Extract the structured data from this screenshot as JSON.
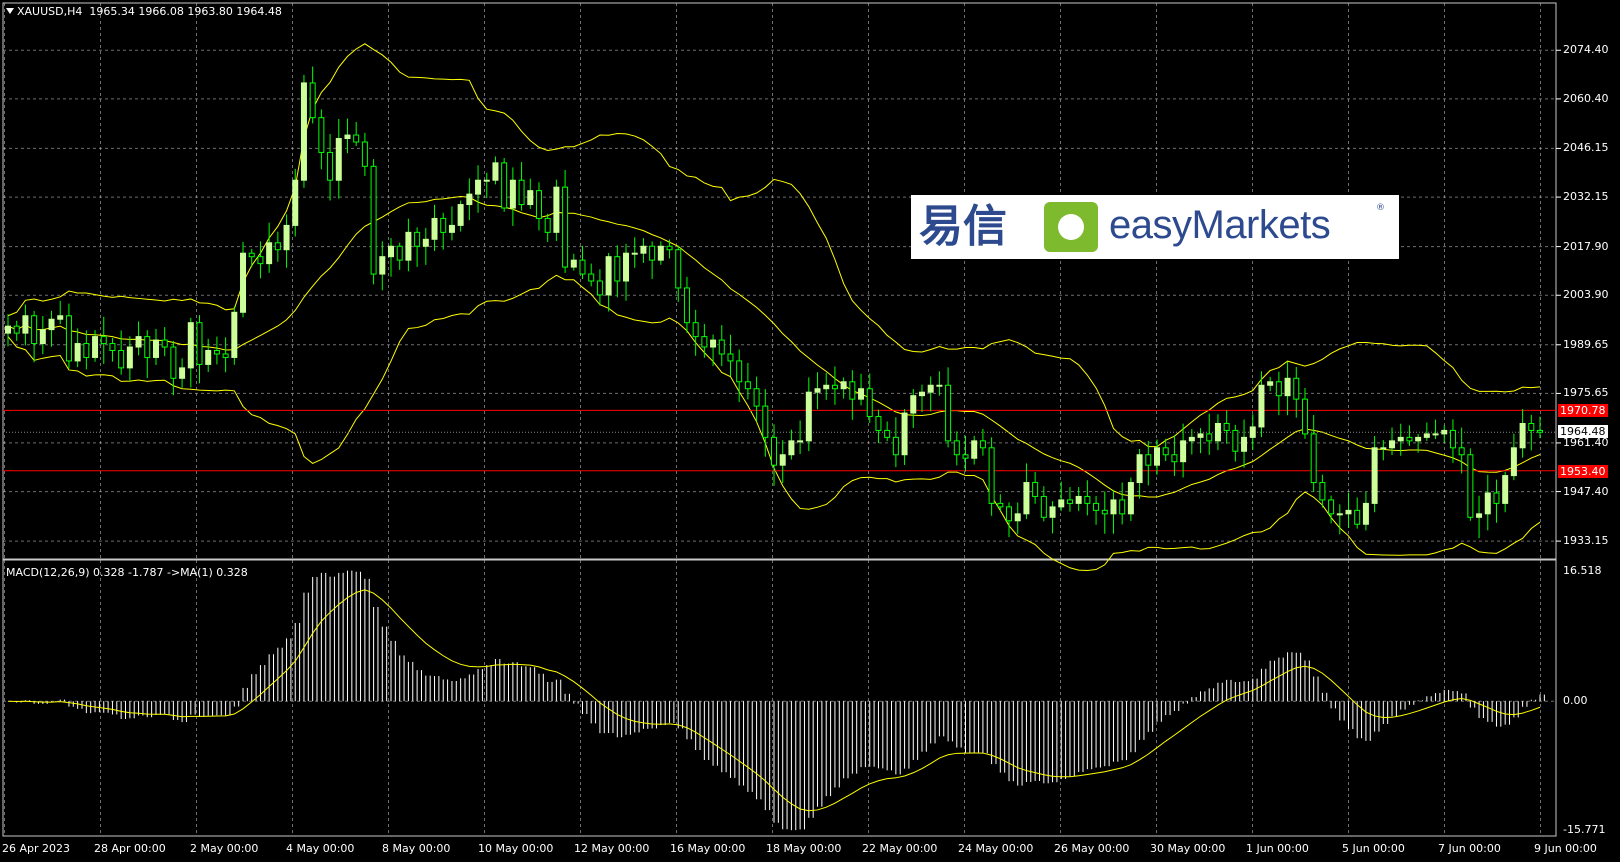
{
  "header": {
    "symbol": "XAUUSD,H4",
    "ohlc": "1965.34 1966.08 1963.80 1964.48"
  },
  "macd_header": "MACD(12,26,9) 0.328 -1.787  ->MA(1) 0.328",
  "logo": {
    "chinese": "易信",
    "english": "easyMarkets",
    "reg": "®"
  },
  "colors": {
    "background": "#000000",
    "grid": "#c8c8c8",
    "bull_candle": "#ccff99",
    "bear_candle": "#00ff00",
    "band": "#ffff00",
    "level": "#ff0000",
    "macd_hist": "#ffffff",
    "signal": "#ffff00"
  },
  "price_levels": {
    "upper": "1970.78",
    "lower": "1953.40",
    "current": "1964.48"
  },
  "chart_data": [
    {
      "type": "candlestick",
      "title": "XAUUSD,H4",
      "y_ticks": [
        "2074.40",
        "2060.40",
        "2046.15",
        "2032.15",
        "2017.90",
        "2003.90",
        "1989.65",
        "1975.65",
        "1961.40",
        "1947.40",
        "1933.15"
      ],
      "x_ticks": [
        "26 Apr 2023",
        "28 Apr 00:00",
        "2 May 00:00",
        "4 May 00:00",
        "8 May 00:00",
        "10 May 00:00",
        "12 May 00:00",
        "16 May 00:00",
        "18 May 00:00",
        "22 May 00:00",
        "24 May 00:00",
        "26 May 00:00",
        "30 May 00:00",
        "1 Jun 00:00",
        "5 Jun 00:00",
        "7 Jun 00:00",
        "9 Jun 00:00"
      ],
      "ylim": [
        1928,
        2088
      ],
      "indicators": [
        "Bollinger Bands (yellow)"
      ],
      "horizontal_levels": [
        1970.78,
        1953.4
      ],
      "last_price": 1964.48,
      "closes": [
        1995,
        1993,
        1998,
        1990,
        1994,
        1997,
        1998,
        1985,
        1990,
        1986,
        1992,
        1990,
        1988,
        1983,
        1989,
        1992,
        1986,
        1991,
        1989,
        1980,
        1983,
        1996,
        1984,
        1988,
        1987,
        1986,
        1999,
        2016,
        2015,
        2013,
        2019,
        2017,
        2024,
        2037,
        2065,
        2055,
        2045,
        2037,
        2049,
        2050,
        2048,
        2041,
        2010,
        2015,
        2018,
        2014,
        2022,
        2018,
        2020,
        2026,
        2022,
        2024,
        2030,
        2033,
        2037,
        2037,
        2042,
        2029,
        2037,
        2030,
        2034,
        2026,
        2022,
        2035,
        2012,
        2014,
        2010,
        2008,
        2004,
        2015,
        2008,
        2016,
        2016,
        2018,
        2014,
        2018,
        2017,
        2006,
        1996,
        1992,
        1989,
        1991,
        1987,
        1985,
        1979,
        1977,
        1972,
        1963,
        1955,
        1958,
        1962,
        1962,
        1976,
        1977,
        1978,
        1977,
        1979,
        1974,
        1977,
        1969,
        1965,
        1963,
        1958,
        1970,
        1975,
        1976,
        1978,
        1978,
        1962,
        1958,
        1957,
        1962,
        1960,
        1944,
        1943,
        1939,
        1941,
        1950,
        1946,
        1940,
        1943,
        1945,
        1944,
        1946,
        1944,
        1942,
        1941,
        1945,
        1941,
        1950,
        1958,
        1955,
        1960,
        1958,
        1956,
        1962,
        1963,
        1964,
        1962,
        1967,
        1965,
        1959,
        1963,
        1966,
        1978,
        1979,
        1975,
        1980,
        1974,
        1964,
        1950,
        1945,
        1941,
        1941,
        1942,
        1938,
        1944,
        1960,
        1960,
        1962,
        1963,
        1962,
        1963,
        1964,
        1964,
        1965,
        1960,
        1958,
        1940,
        1941,
        1947,
        1944,
        1952,
        1960,
        1967,
        1965,
        1964.48
      ]
    },
    {
      "type": "bar",
      "title": "MACD(12,26,9) 0.328 -1.787  ->MA(1) 0.328",
      "y_ticks": [
        "16.518",
        "0.00",
        "-15.771"
      ],
      "ylim": [
        -15.771,
        16.518
      ],
      "series": [
        {
          "name": "MACD",
          "style": "histogram",
          "values": []
        },
        {
          "name": "Signal",
          "style": "line",
          "values": []
        }
      ]
    }
  ]
}
